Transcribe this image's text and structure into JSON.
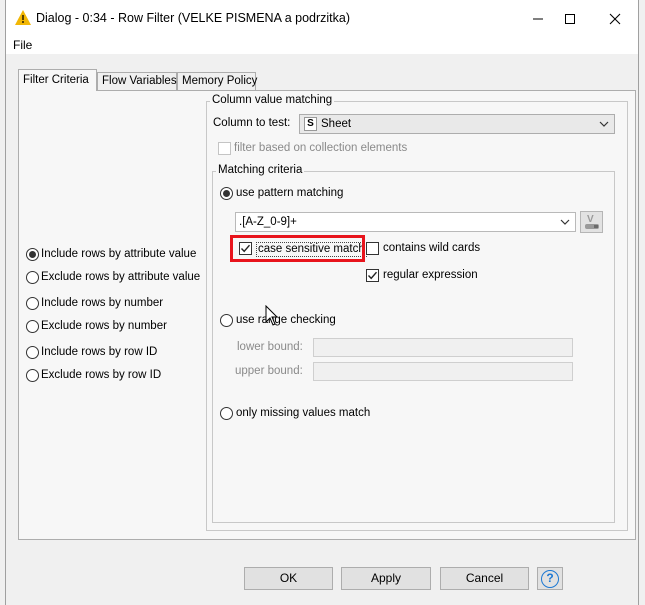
{
  "window": {
    "title": "Dialog - 0:34 - Row Filter (VELKE PISMENA a podrzitka)",
    "minimize": "—",
    "maximize": "☐",
    "close": "✕"
  },
  "menu": {
    "file": "File"
  },
  "tabs": [
    {
      "label": "Filter Criteria",
      "active": true
    },
    {
      "label": "Flow Variables",
      "active": false
    },
    {
      "label": "Memory Policy",
      "active": false
    }
  ],
  "filter_modes": [
    {
      "label": "Include rows by attribute value",
      "selected": true
    },
    {
      "label": "Exclude rows by attribute value",
      "selected": false
    },
    {
      "label": "Include rows by number",
      "selected": false
    },
    {
      "label": "Exclude rows by number",
      "selected": false
    },
    {
      "label": "Include rows by row ID",
      "selected": false
    },
    {
      "label": "Exclude rows by row ID",
      "selected": false
    }
  ],
  "column_matching": {
    "group_title": "Column value matching",
    "column_label": "Column to test:",
    "column_type_badge": "S",
    "column_value": "Sheet",
    "collection_checkbox": {
      "label": "filter based on collection elements",
      "checked": false,
      "enabled": false
    }
  },
  "matching_criteria": {
    "group_title": "Matching criteria",
    "pattern": {
      "label": "use pattern matching",
      "selected": true,
      "value": ".[A-Z_0-9]+"
    },
    "case_sensitive": {
      "label": "case sensitive match",
      "checked": true
    },
    "wild_cards": {
      "label": "contains wild cards",
      "checked": false
    },
    "regex": {
      "label": "regular expression",
      "checked": true
    },
    "range": {
      "label": "use range checking",
      "selected": false
    },
    "lower_bound": {
      "label": "lower bound:",
      "value": ""
    },
    "upper_bound": {
      "label": "upper bound:",
      "value": ""
    },
    "missing": {
      "label": "only missing values match",
      "selected": false
    }
  },
  "buttons": {
    "ok": "OK",
    "apply": "Apply",
    "cancel": "Cancel",
    "help": "?"
  },
  "colors": {
    "highlight": "#e8141c",
    "warning": "#f2b705",
    "help_blue": "#1c78d3"
  }
}
